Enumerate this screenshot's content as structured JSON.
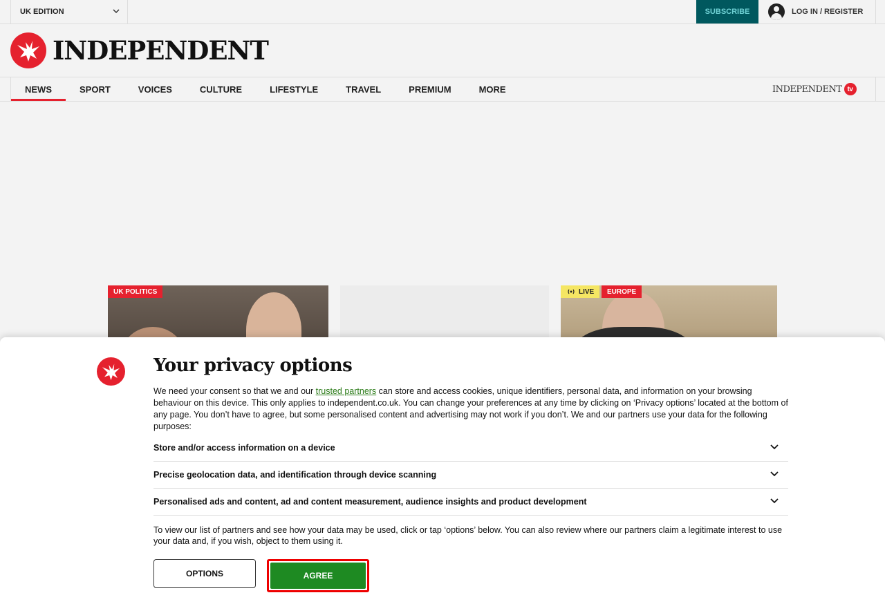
{
  "topbar": {
    "edition_label": "UK EDITION",
    "subscribe_label": "SUBSCRIBE",
    "login_label": "LOG IN / REGISTER"
  },
  "masthead": {
    "brand": "INDEPENDENT"
  },
  "nav": {
    "items": [
      {
        "label": "NEWS",
        "active": true
      },
      {
        "label": "SPORT",
        "active": false
      },
      {
        "label": "VOICES",
        "active": false
      },
      {
        "label": "CULTURE",
        "active": false
      },
      {
        "label": "LIFESTYLE",
        "active": false
      },
      {
        "label": "TRAVEL",
        "active": false
      },
      {
        "label": "PREMIUM",
        "active": false
      },
      {
        "label": "MORE",
        "active": false
      }
    ],
    "tv_brand": "INDEPENDENT",
    "tv_badge": "tv"
  },
  "cards": {
    "card1_tag": "UK POLITICS",
    "card3_live": "LIVE",
    "card3_tag": "EUROPE"
  },
  "privacy": {
    "title": "Your privacy options",
    "intro_before_link": "We need your consent so that we and our ",
    "intro_link": "trusted partners",
    "intro_after_link": " can store and access cookies, unique identifiers, personal data, and information on your browsing behaviour on this device. This only applies to independent.co.uk. You can change your preferences at any time by clicking on ‘Privacy options’ located at the bottom of any page. You don’t have to agree, but some personalised content and advertising may not work if you don’t. We and our partners use your data for the following purposes:",
    "purposes": [
      "Store and/or access information on a device",
      "Precise geolocation data, and identification through device scanning",
      "Personalised ads and content, ad and content measurement, audience insights and product development"
    ],
    "outro": "To view our list of partners and see how your data may be used, click or tap ‘options’ below. You can also review where our partners claim a legitimate interest to use your data and, if you wish, object to them using it.",
    "options_label": "OPTIONS",
    "agree_label": "AGREE"
  },
  "colors": {
    "brand_red": "#e5212e",
    "subscribe_bg": "#00585e",
    "agree_green": "#1e8a22",
    "link_green": "#2b7b18"
  }
}
